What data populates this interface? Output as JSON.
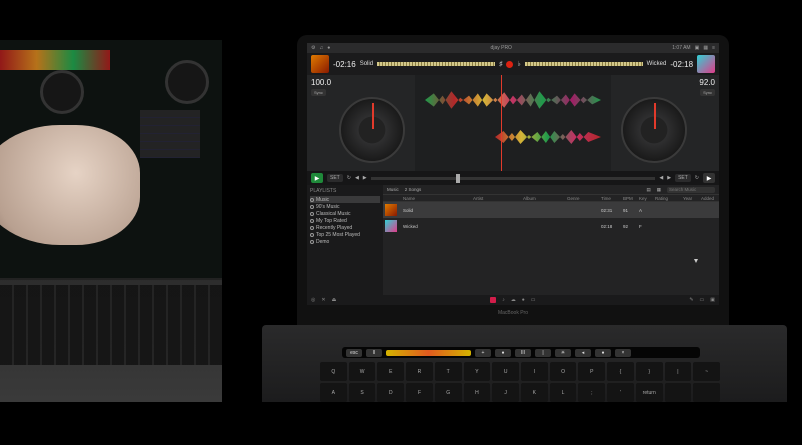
{
  "app": {
    "title": "djay PRO",
    "clock": "1:07 AM"
  },
  "left_deck": {
    "time": "-02:16",
    "track": "Solid",
    "bpm": "100.0",
    "bpm_button": "Sync",
    "set_label": "SET"
  },
  "right_deck": {
    "time": "-02:18",
    "track": "Wicked",
    "bpm": "92.0",
    "bpm_button": "Sync",
    "set_label": "SET"
  },
  "sidebar": {
    "header": "PLAYLISTS",
    "items": [
      {
        "label": "Music"
      },
      {
        "label": "90's Music"
      },
      {
        "label": "Classical Music"
      },
      {
        "label": "My Top Rated"
      },
      {
        "label": "Recently Played"
      },
      {
        "label": "Top 25 Most Played"
      },
      {
        "label": "Demo"
      }
    ]
  },
  "list": {
    "source": "Music",
    "count": "2 Songs",
    "search_placeholder": "Search Music",
    "columns": [
      "",
      "Name",
      "Artist",
      "Album",
      "Genre",
      "Time",
      "BPM",
      "Key",
      "Rating",
      "Year",
      "Added"
    ],
    "rows": [
      {
        "name": "Solid",
        "time": "02:31",
        "bpm": "91",
        "key": "A"
      },
      {
        "name": "Wicked",
        "time": "02:18",
        "bpm": "92",
        "key": "F"
      }
    ]
  },
  "device": {
    "brand": "MacBook Pro"
  },
  "touchbar": {
    "buttons": [
      "esc",
      "II",
      "+",
      "●",
      "III",
      "|",
      "☀",
      "◂",
      "●",
      "×"
    ]
  },
  "keyboard": {
    "keys": [
      "Q",
      "W",
      "E",
      "R",
      "T",
      "Y",
      "U",
      "I",
      "O",
      "P",
      "{",
      "}",
      "|",
      "~",
      "A",
      "S",
      "D",
      "F",
      "G",
      "H",
      "J",
      "K",
      "L",
      ";",
      "'",
      "return",
      "",
      ""
    ]
  },
  "colors": {
    "accent_red": "#e23a2b",
    "play_green": "#1f8a3a",
    "background": "#1d1e1f"
  }
}
